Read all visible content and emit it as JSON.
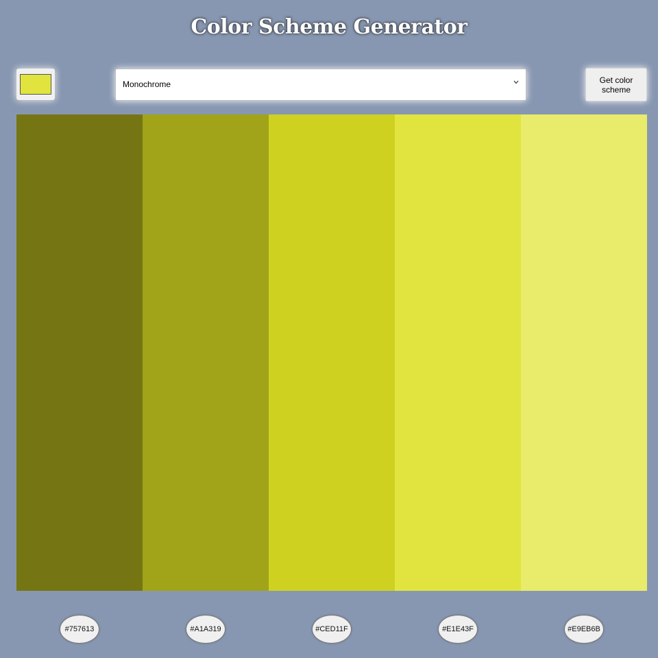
{
  "header": {
    "title": "Color Scheme Generator"
  },
  "controls": {
    "seed_color": "#E1E43F",
    "scheme_select": {
      "selected": "Monochrome",
      "icon": "chevron-down-icon"
    },
    "get_button_label": "Get color scheme"
  },
  "palette": {
    "colors": [
      {
        "hex": "#757613"
      },
      {
        "hex": "#A1A319"
      },
      {
        "hex": "#CED11F"
      },
      {
        "hex": "#E1E43F"
      },
      {
        "hex": "#E9EB6B"
      }
    ]
  },
  "theme": {
    "background": "#8897B1"
  }
}
